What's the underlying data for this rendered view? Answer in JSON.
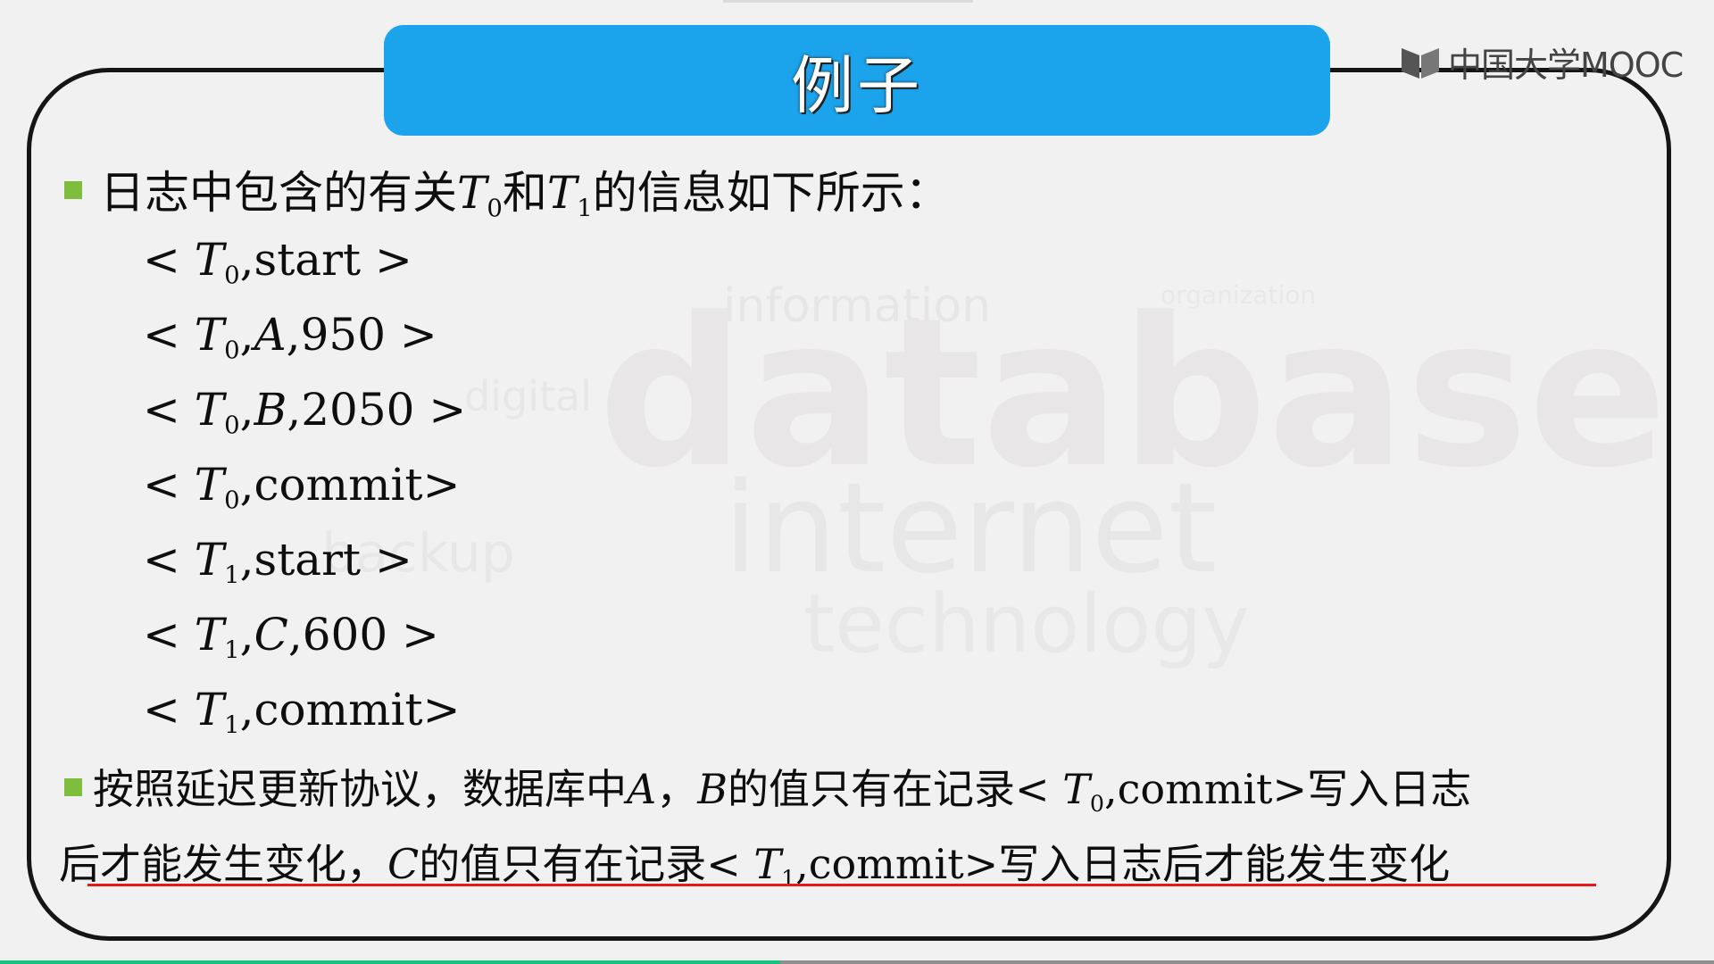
{
  "slide": {
    "title": "例子",
    "brand": "中国大学MOOC",
    "bullet1": {
      "prefix": "日志中包含的有关",
      "t0": "T",
      "sub0": "0",
      "mid": "和",
      "t1": "T",
      "sub1": "1",
      "suffix": "的信息如下所示："
    },
    "log": [
      {
        "open": "< ",
        "T": "T",
        "sub": "0",
        "rest": ",start >"
      },
      {
        "open": "< ",
        "T": "T",
        "sub": "0",
        "sep": ",",
        "var": "A",
        "rest": ",950 >"
      },
      {
        "open": "< ",
        "T": "T",
        "sub": "0",
        "sep": ",",
        "var": "B",
        "rest": ",2050 >"
      },
      {
        "open": "< ",
        "T": "T",
        "sub": "0",
        "rest": ",commit>"
      },
      {
        "open": "< ",
        "T": "T",
        "sub": "1",
        "rest": ",start >"
      },
      {
        "open": "< ",
        "T": "T",
        "sub": "1",
        "sep": ",",
        "var": "C",
        "rest": ",600 >"
      },
      {
        "open": "< ",
        "T": "T",
        "sub": "1",
        "rest": ",commit>"
      }
    ],
    "bullet2": {
      "l1a": "按照延迟更新协议，数据库中",
      "A": "A",
      "comma": "，",
      "B": "B",
      "l1b": "的值只有在记录",
      "rec0_open": "< ",
      "rec0_T": "T",
      "rec0_sub": "0",
      "rec0_rest": ",commit>",
      "l1c": "写入日志",
      "l2a": "后才能发生变化，",
      "C": "C",
      "l2b": "的值只有在记录",
      "rec1_open": "< ",
      "rec1_T": "T",
      "rec1_sub": "1",
      "rec1_rest": ",commit>",
      "l2c": "写入日志后才能发生变化"
    }
  },
  "player": {
    "progress": 0.455
  },
  "colors": {
    "title_bg": "#1ba3ec",
    "bullet": "#7ebe3c",
    "underline": "#e41a1a",
    "progress": "#19c37d"
  }
}
